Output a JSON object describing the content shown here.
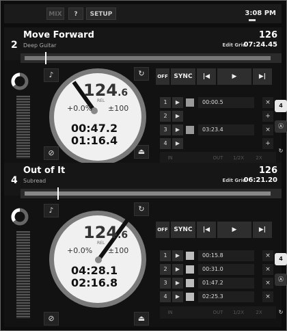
{
  "topbar": {
    "mix_label": "MIX",
    "help_label": "?",
    "setup_label": "SETUP",
    "clock": "3:08 PM"
  },
  "decks": [
    {
      "number": "2",
      "title": "Move Forward",
      "artist": "Deep Guitar",
      "bpm": "126",
      "edit_grid": "Edit Grid",
      "remaining": "07:24.45",
      "tempo_whole": "124",
      "tempo_decimal": ".6",
      "rel": "REL",
      "pitch": "+0.0%",
      "range": "±100",
      "elapsed": "00:47.2",
      "remain_disc": "01:16.4",
      "transport": {
        "off": "OFF",
        "sync": "SYNC"
      },
      "cues": [
        {
          "num": "1",
          "time": "00:00.5",
          "color": "#9a9a9a",
          "clear": "×"
        },
        {
          "num": "2",
          "time": "",
          "color": "",
          "clear": "+"
        },
        {
          "num": "3",
          "time": "03:23.4",
          "color": "#9a9a9a",
          "clear": "×"
        },
        {
          "num": "4",
          "time": "",
          "color": "",
          "clear": "+"
        }
      ],
      "loop": {
        "in": "IN",
        "out": "OUT",
        "half": "1/2X",
        "double": "2X"
      },
      "side_badge": "4"
    },
    {
      "number": "4",
      "title": "Out of It",
      "artist": "Subread",
      "bpm": "126",
      "edit_grid": "Edit Grid",
      "remaining": "06:21.20",
      "tempo_whole": "124",
      "tempo_decimal": ".6",
      "rel": "REL",
      "pitch": "+0.0%",
      "range": "±100",
      "elapsed": "04:28.1",
      "remain_disc": "02:16.8",
      "transport": {
        "off": "OFF",
        "sync": "SYNC"
      },
      "cues": [
        {
          "num": "1",
          "time": "00:15.8",
          "color": "#bdbdbd",
          "clear": "×"
        },
        {
          "num": "2",
          "time": "00:31.0",
          "color": "#bdbdbd",
          "clear": "×"
        },
        {
          "num": "3",
          "time": "01:47.2",
          "color": "#bdbdbd",
          "clear": "×"
        },
        {
          "num": "4",
          "time": "02:25.3",
          "color": "#bdbdbd",
          "clear": "×"
        }
      ],
      "loop": {
        "in": "IN",
        "out": "OUT",
        "half": "1/2X",
        "double": "2X"
      },
      "side_badge": "4"
    }
  ]
}
